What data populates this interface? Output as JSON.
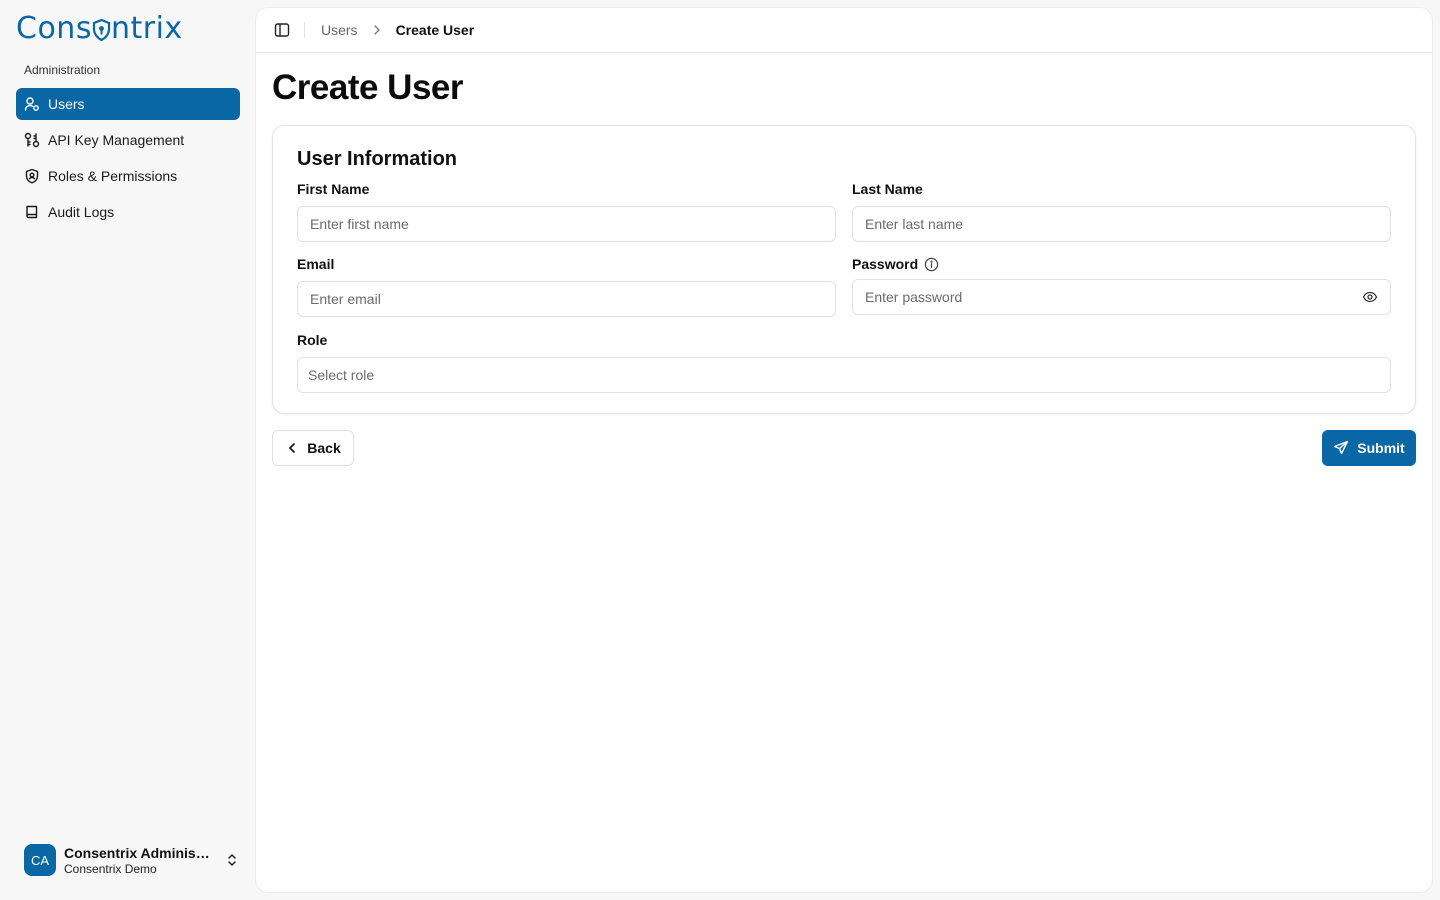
{
  "brand": {
    "logo_text": "Consentrix",
    "logo_prefix": "Cons",
    "logo_suffix": "ntrix",
    "accent": "#0a67a5"
  },
  "sidebar": {
    "section_label": "Administration",
    "items": [
      {
        "label": "Users",
        "icon": "user-icon",
        "active": true
      },
      {
        "label": "API Key Management",
        "icon": "key-icon",
        "active": false
      },
      {
        "label": "Roles & Permissions",
        "icon": "shield-icon",
        "active": false
      },
      {
        "label": "Audit Logs",
        "icon": "book-icon",
        "active": false
      }
    ],
    "user": {
      "initials": "CA",
      "name": "Consentrix Administrator",
      "org": "Consentrix Demo"
    }
  },
  "header": {
    "breadcrumb": [
      {
        "label": "Users"
      },
      {
        "label": "Create User"
      }
    ]
  },
  "page": {
    "title": "Create User",
    "card_title": "User Information",
    "fields": {
      "first_name": {
        "label": "First Name",
        "placeholder": "Enter first name",
        "value": ""
      },
      "last_name": {
        "label": "Last Name",
        "placeholder": "Enter last name",
        "value": ""
      },
      "email": {
        "label": "Email",
        "placeholder": "Enter email",
        "value": ""
      },
      "password": {
        "label": "Password",
        "placeholder": "Enter password",
        "value": ""
      },
      "role": {
        "label": "Role",
        "placeholder": "Select role",
        "value": ""
      }
    },
    "back_label": "Back",
    "submit_label": "Submit"
  }
}
